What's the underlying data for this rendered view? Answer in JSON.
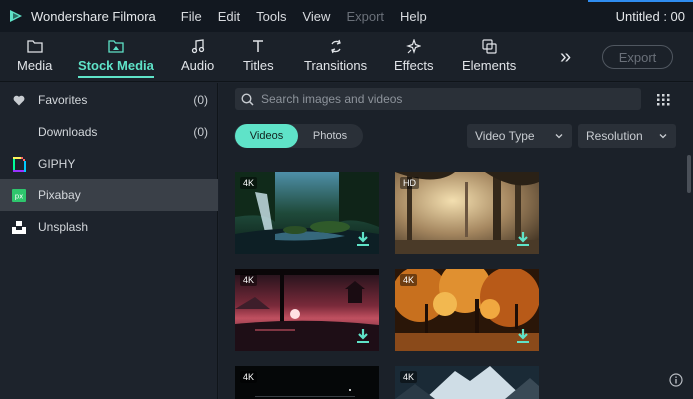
{
  "titlebar": {
    "app_name": "Wondershare Filmora",
    "menu": [
      "File",
      "Edit",
      "Tools",
      "View",
      "Export",
      "Help"
    ],
    "document_title": "Untitled : 00"
  },
  "toolbar": {
    "tabs": [
      {
        "label": "Media",
        "icon": "folder-icon"
      },
      {
        "label": "Stock Media",
        "icon": "stock-folder-icon",
        "active": true
      },
      {
        "label": "Audio",
        "icon": "music-note-icon"
      },
      {
        "label": "Titles",
        "icon": "text-t-icon"
      },
      {
        "label": "Transitions",
        "icon": "transition-arrows-icon"
      },
      {
        "label": "Effects",
        "icon": "sparkle-icon"
      },
      {
        "label": "Elements",
        "icon": "elements-icon"
      }
    ],
    "more_label": "»",
    "export_label": "Export"
  },
  "sidebar": {
    "items": [
      {
        "label": "Favorites",
        "count": "(0)",
        "icon": "heart-icon"
      },
      {
        "label": "Downloads",
        "count": "(0)",
        "icon": ""
      },
      {
        "label": "GIPHY",
        "count": "",
        "icon": "giphy-icon"
      },
      {
        "label": "Pixabay",
        "count": "",
        "icon": "pixabay-icon",
        "active": true
      },
      {
        "label": "Unsplash",
        "count": "",
        "icon": "unsplash-icon"
      }
    ]
  },
  "main": {
    "search": {
      "placeholder": "Search images and videos"
    },
    "segment": {
      "videos_label": "Videos",
      "photos_label": "Photos"
    },
    "filters": {
      "video_type_label": "Video Type",
      "resolution_label": "Resolution"
    },
    "thumbnails": [
      {
        "badge": "4K",
        "desc": "waterfall-forest"
      },
      {
        "badge": "HD",
        "desc": "misty-forest-sunlight"
      },
      {
        "badge": "4K",
        "desc": "pagoda-sunset"
      },
      {
        "badge": "4K",
        "desc": "autumn-park"
      },
      {
        "badge": "4K",
        "desc": "dark-night"
      },
      {
        "badge": "4K",
        "desc": "snowy-mountains"
      }
    ]
  },
  "colors": {
    "accent": "#5fe3c8",
    "titlebar_bg": "#121820",
    "panel_bg": "#1b2129",
    "sidebar_active": "#3a4048"
  }
}
